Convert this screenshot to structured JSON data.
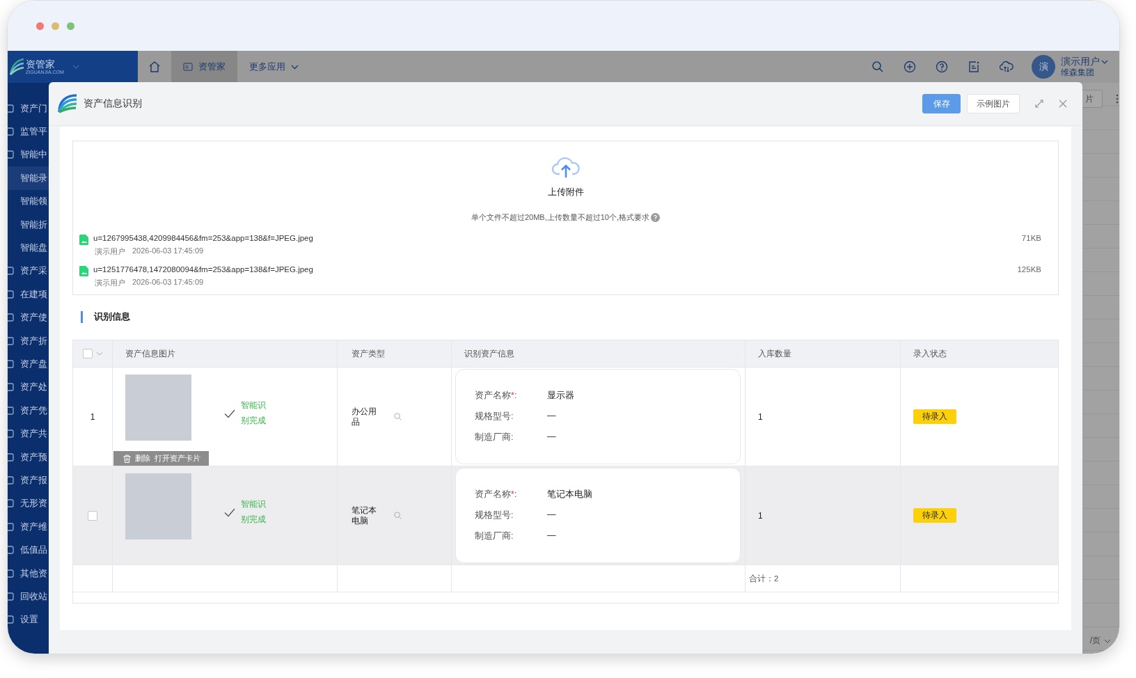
{
  "app": {
    "logo": {
      "name": "资管家",
      "subtitle": "ZIGUANJIA.COM"
    },
    "nav": [
      {
        "kind": "home",
        "selected": false
      },
      {
        "kind": "tab",
        "label": "资管家",
        "selected": true
      },
      {
        "kind": "menu",
        "label": "更多应用",
        "selected": false
      }
    ],
    "user": {
      "avatar": "演",
      "name": "演示用户",
      "org": "维森集团"
    },
    "sidebar": [
      {
        "label": "资产门",
        "kind": "group",
        "selected": false
      },
      {
        "label": "监管平",
        "kind": "group",
        "selected": false
      },
      {
        "label": "智能中",
        "kind": "group",
        "selected": false
      },
      {
        "label": "智能录",
        "kind": "sub",
        "selected": true
      },
      {
        "label": "智能领",
        "kind": "sub",
        "selected": false
      },
      {
        "label": "智能折",
        "kind": "sub",
        "selected": false
      },
      {
        "label": "智能盘",
        "kind": "sub",
        "selected": false
      },
      {
        "label": "资产采",
        "kind": "group",
        "selected": false
      },
      {
        "label": "在建项",
        "kind": "group",
        "selected": false
      },
      {
        "label": "资产使",
        "kind": "group",
        "selected": false
      },
      {
        "label": "资产折",
        "kind": "group",
        "selected": false
      },
      {
        "label": "资产盘",
        "kind": "group",
        "selected": false
      },
      {
        "label": "资产处",
        "kind": "group",
        "selected": false
      },
      {
        "label": "资产凭",
        "kind": "group",
        "selected": false
      },
      {
        "label": "资产共",
        "kind": "group",
        "selected": false
      },
      {
        "label": "资产预",
        "kind": "group",
        "selected": false
      },
      {
        "label": "资产报",
        "kind": "group",
        "selected": false
      },
      {
        "label": "无形资",
        "kind": "group",
        "selected": false
      },
      {
        "label": "资产维",
        "kind": "group",
        "selected": false
      },
      {
        "label": "低值品",
        "kind": "group",
        "selected": false
      },
      {
        "label": "其他资",
        "kind": "group",
        "selected": false
      },
      {
        "label": "回收站",
        "kind": "group",
        "selected": false
      },
      {
        "label": "设置",
        "kind": "group",
        "selected": false
      }
    ],
    "background": {
      "button": "片",
      "pager": "/页"
    }
  },
  "modal": {
    "title": "资产信息识别",
    "buttons": [
      {
        "label": "保存",
        "kind": "primary"
      },
      {
        "label": "示例图片",
        "kind": "default"
      }
    ],
    "upload": {
      "label": "上传附件",
      "hint": "单个文件不超过20MB,上传数量不超过10个,格式要求",
      "files": [
        {
          "name": "u=1267995438,4209984456&fm=253&app=138&f=JPEG.jpeg",
          "user": "演示用户",
          "time": "2026-06-03 17:45:09",
          "size": "71KB"
        },
        {
          "name": "u=1251776478,1472080094&fm=253&app=138&f=JPEG.jpeg",
          "user": "演示用户",
          "time": "2026-06-03 17:45:09",
          "size": "125KB"
        }
      ]
    },
    "section_title": "识别信息",
    "table": {
      "header_checked": false,
      "columns": [
        "资产信息图片",
        "资产类型",
        "识别资产信息",
        "入库数量",
        "录入状态"
      ],
      "rows": [
        {
          "kind": "index",
          "index": "1",
          "highlighted": false,
          "recognized": true,
          "recognition": "智能识别完成",
          "type": "办公用品",
          "fields": [
            {
              "label": "资产名称",
              "required_mark": "*",
              "suffix": ":",
              "value": "显示器"
            },
            {
              "label": "规格型号",
              "suffix": ":",
              "value": "—"
            },
            {
              "label": "制造厂商",
              "suffix": ":",
              "value": "—"
            }
          ],
          "quantity": "1",
          "status": "待录入",
          "actions": [
            "删除",
            "打开资产卡片"
          ]
        },
        {
          "kind": "checkbox",
          "checked": false,
          "highlighted": true,
          "recognized": true,
          "recognition": "智能识别完成",
          "type": "笔记本电脑",
          "fields": [
            {
              "label": "资产名称",
              "required_mark": "*",
              "suffix": ":",
              "value": "笔记本电脑"
            },
            {
              "label": "规格型号",
              "suffix": ":",
              "value": "—"
            },
            {
              "label": "制造厂商",
              "suffix": ":",
              "value": "—"
            }
          ],
          "quantity": "1",
          "status": "待录入"
        }
      ],
      "total": "合计：2"
    }
  }
}
